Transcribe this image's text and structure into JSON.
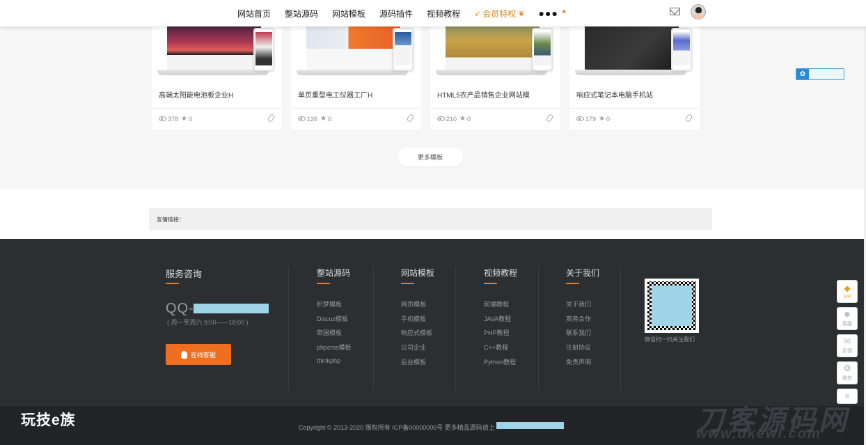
{
  "nav": {
    "items": [
      "网站首页",
      "整站源码",
      "网站模板",
      "源码插件",
      "视频教程"
    ],
    "vip_label": "会员特权",
    "more_label": "●●●"
  },
  "cards": [
    {
      "title": "高端太阳能电池板企业H",
      "views": "378",
      "stars": "0"
    },
    {
      "title": "单页重型电工仪器工厂H",
      "views": "126",
      "stars": "0"
    },
    {
      "title": "HTML5农产品销售企业网站模",
      "views": "210",
      "stars": "0"
    },
    {
      "title": "响应式笔记本电脑手机站",
      "views": "179",
      "stars": "0"
    }
  ],
  "more_button": "更多模板",
  "friend_links_label": "友情链接：",
  "footer": {
    "service_title": "服务咨询",
    "qq_label": "QQ-",
    "hours": "( 周一至周六 9:00——18:00 )",
    "service_button": "在线客服",
    "columns": [
      {
        "title": "整站源码",
        "items": [
          "织梦模板",
          "Discuz模板",
          "帝国模板",
          "phpcms模板",
          "thinkphp"
        ]
      },
      {
        "title": "网站模板",
        "items": [
          "网页模板",
          "手机模板",
          "响应式模板",
          "公司企业",
          "后台模板"
        ]
      },
      {
        "title": "视频教程",
        "items": [
          "前端教程",
          "JAVA教程",
          "PHP教程",
          "C++教程",
          "Python教程"
        ]
      },
      {
        "title": "关于我们",
        "items": [
          "关于我们",
          "商务合作",
          "联系我们",
          "注册协议",
          "免责声明"
        ]
      }
    ],
    "qr_caption": "微信扫一扫关注我们",
    "copyright": "Copyright © 2013-2020 版权所有 ICP备00000000号 更多精品源码请上"
  },
  "watermarks": {
    "left": "玩技e族",
    "right_cn": "刀客源码网",
    "right_url": "www.dkewl.com"
  },
  "side_buttons": [
    {
      "icon": "vip-icon",
      "label": "VIP"
    },
    {
      "icon": "user-icon",
      "label": "客服"
    },
    {
      "icon": "mail-icon",
      "label": "反馈"
    },
    {
      "icon": "wechat-icon",
      "label": "微信"
    },
    {
      "icon": "top-icon",
      "label": ""
    }
  ],
  "colors": {
    "accent": "#ee6f1f",
    "vip": "#e08a1e",
    "footer_bg": "#2d2e31",
    "share_blue": "#2a8ad4"
  }
}
